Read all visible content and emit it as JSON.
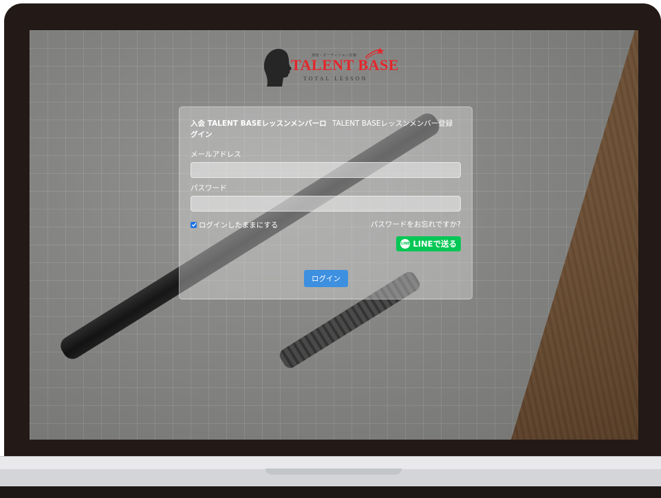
{
  "logo": {
    "tagline": "演技・オーディション対策",
    "name": "TALENT BASE",
    "subtitle": "TOTAL LESSON"
  },
  "card": {
    "tab_login": "入会 TALENT BASEレッスンメンバーログイン",
    "tab_register": "TALENT BASEレッスンメンバー登録"
  },
  "form": {
    "email_label": "メールアドレス",
    "email_value": "",
    "password_label": "パスワード",
    "password_value": "",
    "remember_label": "ログインしたままにする",
    "remember_checked": true,
    "forgot_link": "パスワードをお忘れですか?",
    "line_button": "LINEで送る",
    "line_icon_text": "LINE",
    "login_button": "ログイン"
  },
  "colors": {
    "line_green": "#06c755",
    "login_blue": "#3d8fe0",
    "brand_red": "#e4262b"
  }
}
